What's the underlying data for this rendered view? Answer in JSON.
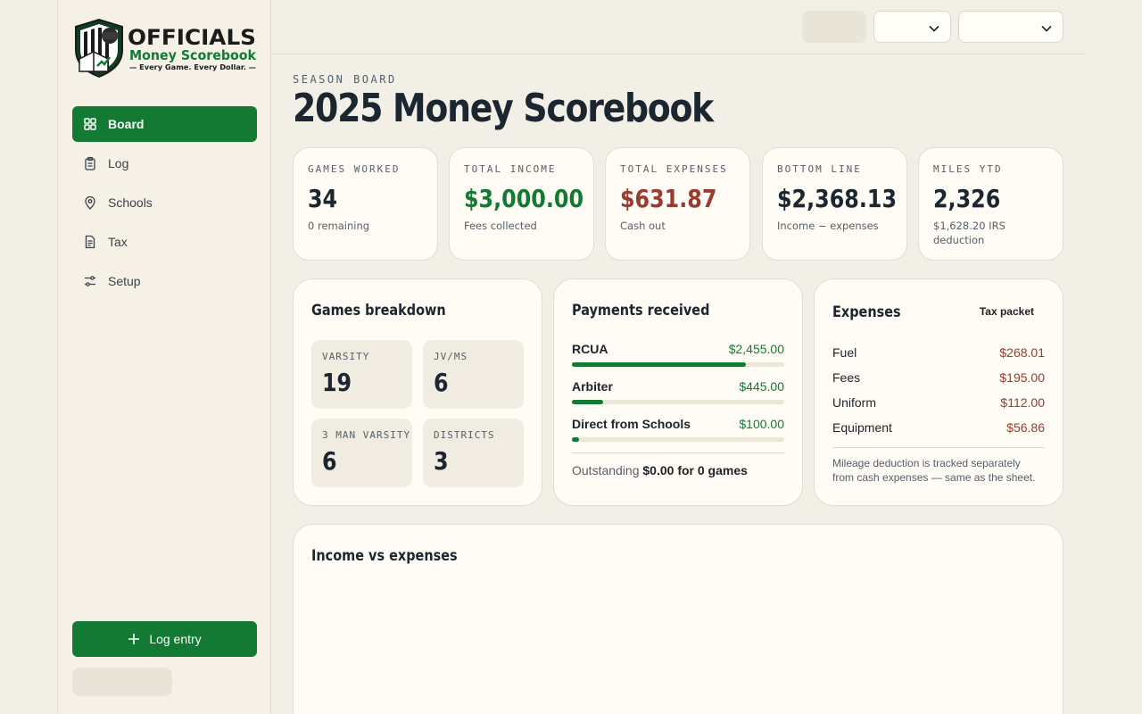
{
  "brand": {
    "logo_line1": "OFFICIALS",
    "logo_line2": "Money Scorebook",
    "logo_tagline": "— Every Game. Every Dollar. —"
  },
  "sidebar": {
    "items": [
      {
        "label": "Board",
        "icon": "grid-icon",
        "active": true
      },
      {
        "label": "Log",
        "icon": "clipboard-icon",
        "active": false
      },
      {
        "label": "Schools",
        "icon": "map-pin-icon",
        "active": false
      },
      {
        "label": "Tax",
        "icon": "receipt-icon",
        "active": false
      },
      {
        "label": "Setup",
        "icon": "sliders-icon",
        "active": false
      }
    ],
    "log_entry_label": "Log entry"
  },
  "header": {
    "eyebrow": "SEASON BOARD",
    "title": "2025 Money Scorebook"
  },
  "stats": [
    {
      "label": "GAMES WORKED",
      "value": "34",
      "sub": "0 remaining",
      "tone": "default"
    },
    {
      "label": "TOTAL INCOME",
      "value": "$3,000.00",
      "sub": "Fees collected",
      "tone": "green"
    },
    {
      "label": "TOTAL EXPENSES",
      "value": "$631.87",
      "sub": "Cash out",
      "tone": "red"
    },
    {
      "label": "BOTTOM LINE",
      "value": "$2,368.13",
      "sub": "Income − expenses",
      "tone": "default"
    },
    {
      "label": "MILES YTD",
      "value": "2,326",
      "sub": "$1,628.20 IRS deduction",
      "tone": "default"
    }
  ],
  "games_breakdown": {
    "title": "Games breakdown",
    "tiles": [
      {
        "label": "VARSITY",
        "value": "19"
      },
      {
        "label": "JV/MS",
        "value": "6"
      },
      {
        "label": "3 MAN VARSITY",
        "value": "6"
      },
      {
        "label": "DISTRICTS",
        "value": "3"
      }
    ]
  },
  "payments": {
    "title": "Payments received",
    "rows": [
      {
        "name": "RCUA",
        "amount": "$2,455.00",
        "fraction": 0.818
      },
      {
        "name": "Arbiter",
        "amount": "$445.00",
        "fraction": 0.148
      },
      {
        "name": "Direct from Schools",
        "amount": "$100.00",
        "fraction": 0.033
      }
    ],
    "outstanding_label": "Outstanding",
    "outstanding_value": "$0.00 for 0 games"
  },
  "expenses": {
    "title": "Expenses",
    "tax_packet_label": "Tax packet",
    "rows": [
      {
        "name": "Fuel",
        "amount": "$268.01"
      },
      {
        "name": "Fees",
        "amount": "$195.00"
      },
      {
        "name": "Uniform",
        "amount": "$112.00"
      },
      {
        "name": "Equipment",
        "amount": "$56.86"
      }
    ],
    "note": "Mileage deduction is tracked separately from cash expenses — same as the sheet."
  },
  "income_chart": {
    "title": "Income vs expenses"
  },
  "colors": {
    "accent": "#137a34",
    "expense": "#993b30",
    "background": "#f2efe6",
    "card": "#fffcf5"
  }
}
